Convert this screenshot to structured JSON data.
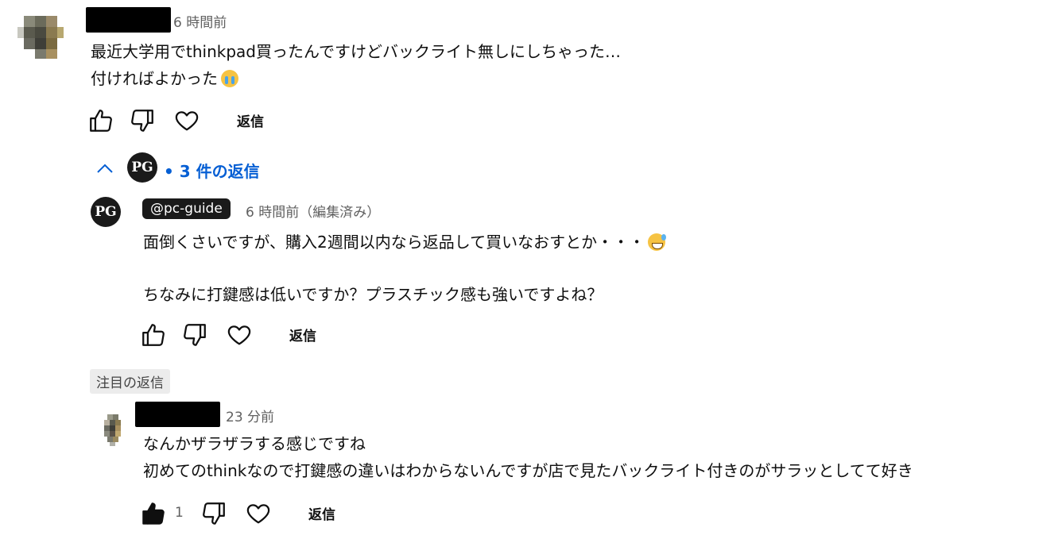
{
  "comments": [
    {
      "time": "6 時間前",
      "lines": [
        "最近大学用でthinkpad買ったんですけどバックライト無しにしちゃった…",
        "付ければよかった"
      ],
      "emoji": "loudly-crying-face",
      "reply_label": "返信"
    }
  ],
  "replies_toggle": {
    "creator_logo": "PG",
    "text": "• 3 件の返信"
  },
  "reply1": {
    "author": "@pc-guide",
    "logo": "PG",
    "time": "6 時間前（編集済み）",
    "line1": "面倒くさいですが、購入2週間以内なら返品して買いなおすとか・・・",
    "line1_emoji": "grinning-face-with-sweat",
    "line2": "ちなみに打鍵感は低いですか？プラスチック感も強いですよね？",
    "reply_label": "返信"
  },
  "highlighted_badge": "注目の返信",
  "reply2": {
    "time": "23 分前",
    "line1": "なんかザラザラする感じですね",
    "line2": "初めてのthinkなので打鍵感の違いはわからないんですが店で見たバックライト付きのがサラッとしてて好き",
    "like_count": "1",
    "reply_label": "返信"
  },
  "colors": {
    "link_blue": "#065fd4",
    "meta_gray": "#606060",
    "badge_bg": "#ececec"
  }
}
